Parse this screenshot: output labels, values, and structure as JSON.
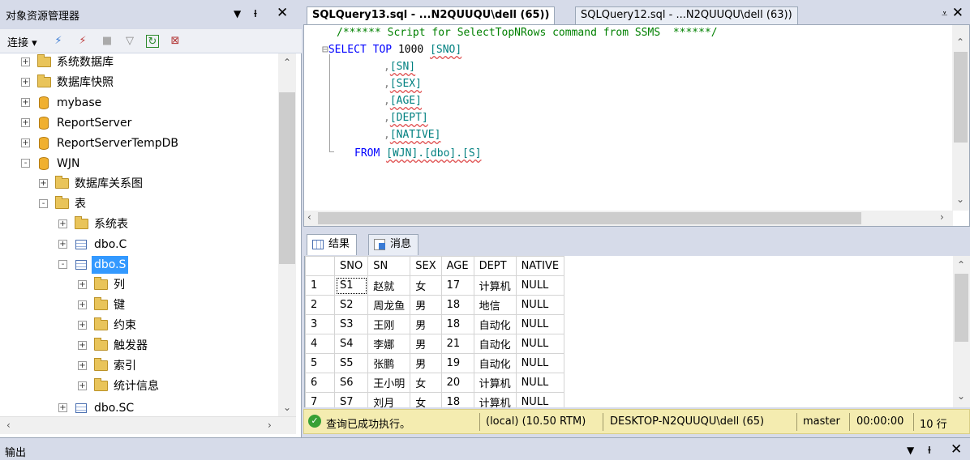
{
  "object_explorer": {
    "title": "对象资源管理器",
    "connect_label": "连接",
    "tree": [
      {
        "label": "系统数据库",
        "icon": "folder-icon",
        "depth": 0,
        "expander": "+"
      },
      {
        "label": "数据库快照",
        "icon": "folder-icon",
        "depth": 0,
        "expander": "+"
      },
      {
        "label": "mybase",
        "icon": "database-icon",
        "depth": 0,
        "expander": "+"
      },
      {
        "label": "ReportServer",
        "icon": "database-icon",
        "depth": 0,
        "expander": "+"
      },
      {
        "label": "ReportServerTempDB",
        "icon": "database-icon",
        "depth": 0,
        "expander": "+"
      },
      {
        "label": "WJN",
        "icon": "database-icon",
        "depth": 0,
        "expander": "-"
      },
      {
        "label": "数据库关系图",
        "icon": "folder-icon",
        "depth": 1,
        "expander": "+"
      },
      {
        "label": "表",
        "icon": "folder-icon",
        "depth": 1,
        "expander": "-"
      },
      {
        "label": "系统表",
        "icon": "folder-icon",
        "depth": 2,
        "expander": "+"
      },
      {
        "label": "dbo.C",
        "icon": "table-icon",
        "depth": 2,
        "expander": "+"
      },
      {
        "label": "dbo.S",
        "icon": "table-icon",
        "depth": 2,
        "expander": "-",
        "selected": true
      },
      {
        "label": "列",
        "icon": "folder-icon",
        "depth": 3,
        "expander": "+"
      },
      {
        "label": "键",
        "icon": "folder-icon",
        "depth": 3,
        "expander": "+"
      },
      {
        "label": "约束",
        "icon": "folder-icon",
        "depth": 3,
        "expander": "+"
      },
      {
        "label": "触发器",
        "icon": "folder-icon",
        "depth": 3,
        "expander": "+"
      },
      {
        "label": "索引",
        "icon": "folder-icon",
        "depth": 3,
        "expander": "+"
      },
      {
        "label": "统计信息",
        "icon": "folder-icon",
        "depth": 3,
        "expander": "+"
      },
      {
        "label": "dbo.SC",
        "icon": "table-icon",
        "depth": 2,
        "expander": "+"
      }
    ]
  },
  "tabs": {
    "active": "SQLQuery13.sql - ...N2QUUQU\\dell (65))",
    "inactive": "SQLQuery12.sql - ...N2QUUQU\\dell (63))"
  },
  "editor": {
    "comment": "/****** Script for SelectTopNRows command from SSMS  ******/",
    "select_kw": "SELECT",
    "top_kw": "TOP",
    "top_n": "1000",
    "columns": [
      "[SNO]",
      "[SN]",
      "[SEX]",
      "[AGE]",
      "[DEPT]",
      "[NATIVE]"
    ],
    "from_kw": "FROM",
    "from_target": "[WJN].[dbo].[S]"
  },
  "results": {
    "tab_results": "结果",
    "tab_messages": "消息",
    "columns": [
      "SNO",
      "SN",
      "SEX",
      "AGE",
      "DEPT",
      "NATIVE"
    ],
    "rows": [
      [
        "1",
        "S1",
        "赵就",
        "女",
        "17",
        "计算机",
        "NULL"
      ],
      [
        "2",
        "S2",
        "周龙鱼",
        "男",
        "18",
        "地信",
        "NULL"
      ],
      [
        "3",
        "S3",
        "王刚",
        "男",
        "18",
        "自动化",
        "NULL"
      ],
      [
        "4",
        "S4",
        "李娜",
        "男",
        "21",
        "自动化",
        "NULL"
      ],
      [
        "5",
        "S5",
        "张鹏",
        "男",
        "19",
        "自动化",
        "NULL"
      ],
      [
        "6",
        "S6",
        "王小明",
        "女",
        "20",
        "计算机",
        "NULL"
      ],
      [
        "7",
        "S7",
        "刘月",
        "女",
        "18",
        "计算机",
        "NULL"
      ]
    ]
  },
  "status": {
    "message": "查询已成功执行。",
    "server": "(local) (10.50 RTM)",
    "user": "DESKTOP-N2QUUQU\\dell (65)",
    "database": "master",
    "time": "00:00:00",
    "rows": "10 行"
  },
  "output": {
    "title": "输出"
  }
}
